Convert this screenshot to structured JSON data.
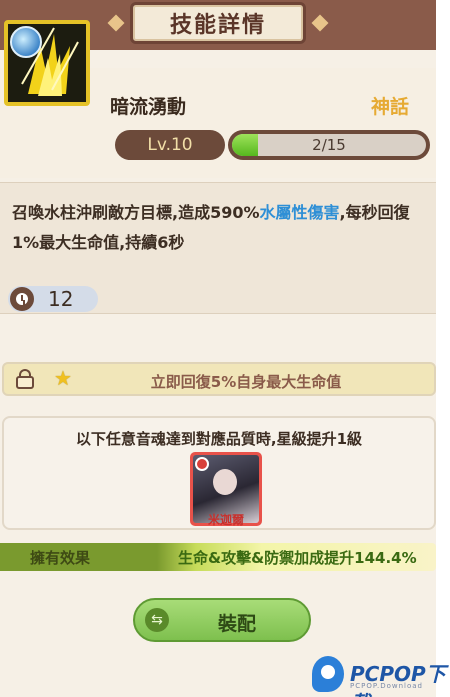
{
  "header": {
    "title": "技能詳情"
  },
  "skill": {
    "name": "暗流湧動",
    "rarity": "神話",
    "level": "Lv.10",
    "progress_text": "2/15",
    "progress_fraction": 0.133,
    "description_part1": "召喚水柱沖刷敵方目標,造成590%",
    "description_highlight": "水屬性傷害",
    "description_part2": ",每秒回復1%最大生命值,持續6秒",
    "cooldown": "12"
  },
  "star_bonus": {
    "text": "立即回復5%自身最大生命值"
  },
  "upgrade": {
    "hint": "以下任意音魂達到對應品質時,星級提升1級",
    "card_name": "米迦爾"
  },
  "effect": {
    "label": "擁有效果",
    "value": "生命&攻擊&防禦加成提升144.4%"
  },
  "equip_button": {
    "label": "裝配"
  },
  "watermark": {
    "text": "PCPOP下载",
    "sub": "PCPOP.Download"
  },
  "colors": {
    "header_bg": "#8a5b4a",
    "rarity": "#e6aa33",
    "highlight": "#2e8fd6",
    "progress_fill": "#56b81e",
    "button": "#7ec04e"
  },
  "icons": [
    "water-element-icon",
    "clock-icon",
    "lock-icon",
    "star-icon",
    "swap-icon"
  ]
}
